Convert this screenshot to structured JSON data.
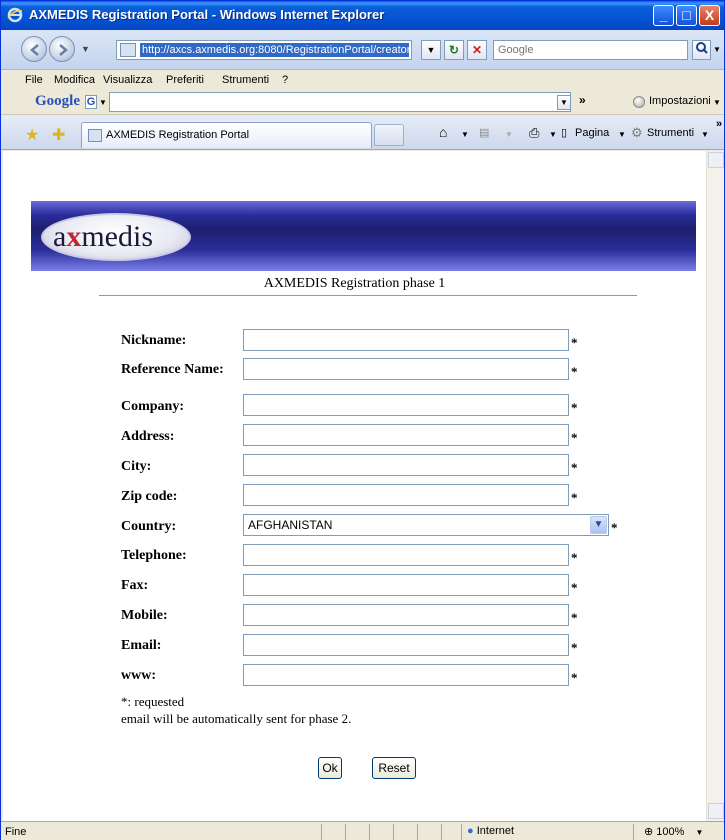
{
  "window": {
    "title": "AXMEDIS Registration Portal - Windows Internet Explorer",
    "minimize": "_",
    "maximize": "□",
    "close": "X"
  },
  "addressbar": {
    "url": "http://axcs.axmedis.org:8080/RegistrationPortal/creator.jsp",
    "search_placeholder": "Google"
  },
  "menu": [
    "File",
    "Modifica",
    "Visualizza",
    "Preferiti",
    "Strumenti",
    "?"
  ],
  "google_toolbar": {
    "logo": "Google",
    "settings_label": "Impostazioni"
  },
  "tab": {
    "label": "AXMEDIS Registration Portal"
  },
  "commandbar": {
    "page_label": "Pagina",
    "tools_label": "Strumenti"
  },
  "page": {
    "logo_text_a": "a",
    "logo_text_x": "x",
    "logo_text_rest": "medis",
    "title": "AXMEDIS Registration phase 1",
    "required_marker": "*",
    "fields": [
      {
        "label": "Nickname:"
      },
      {
        "label": "Reference Name:"
      },
      {
        "label": "Company:"
      },
      {
        "label": "Address:"
      },
      {
        "label": "City:"
      },
      {
        "label": "Zip code:"
      },
      {
        "label": "Country:",
        "value": "AFGHANISTAN"
      },
      {
        "label": "Telephone:"
      },
      {
        "label": "Fax:"
      },
      {
        "label": "Mobile:"
      },
      {
        "label": "Email:"
      },
      {
        "label": "www:"
      }
    ],
    "note_required": "*: requested",
    "note_email": "email will be automatically sent for phase 2.",
    "ok_label": "Ok",
    "reset_label": "Reset"
  },
  "statusbar": {
    "text": "Fine",
    "zone": "Internet",
    "zoom": "100%"
  },
  "colors": {
    "titlebar": "#0553d4",
    "url_highlight": "#316ac5",
    "banner": "#2a2d9a",
    "logo_x": "#c0262b"
  }
}
